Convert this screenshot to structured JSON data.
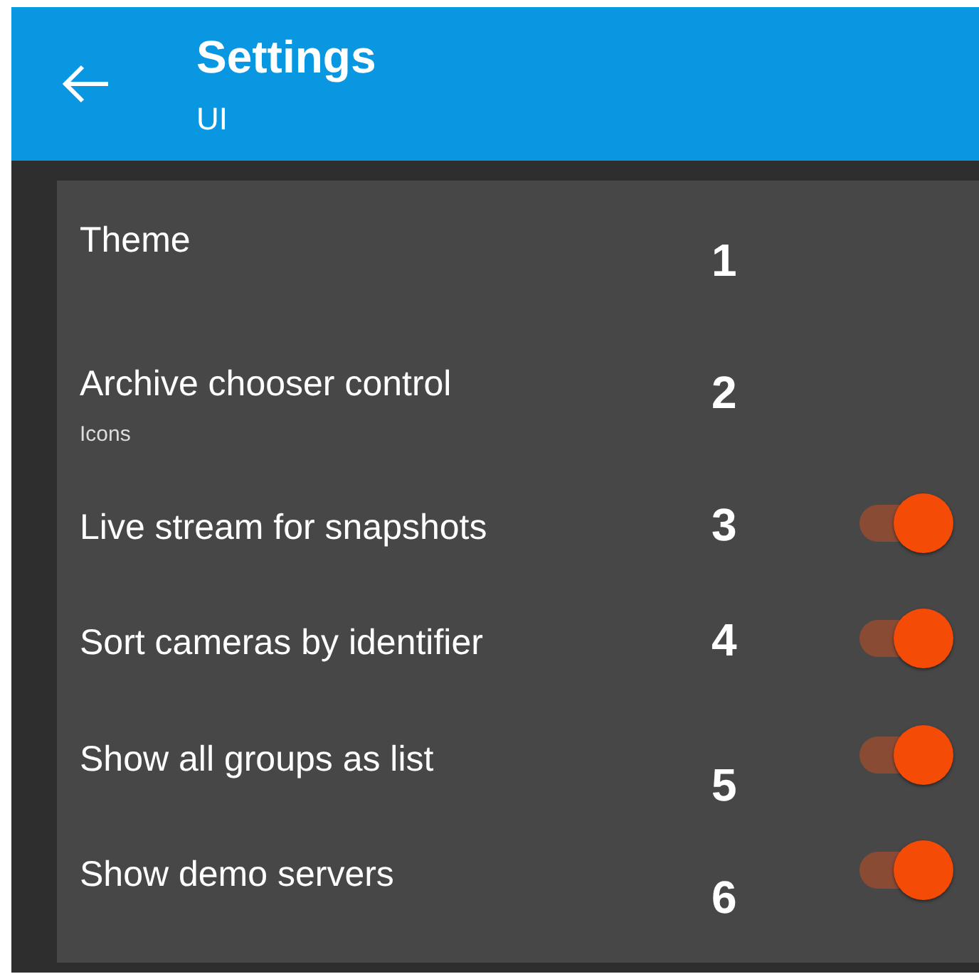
{
  "app_bar": {
    "title": "Settings",
    "subtitle": "UI"
  },
  "settings": [
    {
      "kind": "choice",
      "label": "Theme",
      "callout": "1"
    },
    {
      "kind": "choice",
      "label": "Archive chooser control",
      "summary": "Icons",
      "callout": "2"
    },
    {
      "kind": "switch",
      "label": "Live stream for snapshots",
      "on": true,
      "callout": "3"
    },
    {
      "kind": "switch",
      "label": "Sort cameras by identifier",
      "on": true,
      "callout": "4"
    },
    {
      "kind": "switch",
      "label": "Show all groups as list",
      "on": true,
      "callout": "5"
    },
    {
      "kind": "switch",
      "label": "Show demo servers",
      "on": true,
      "callout": "6"
    }
  ]
}
